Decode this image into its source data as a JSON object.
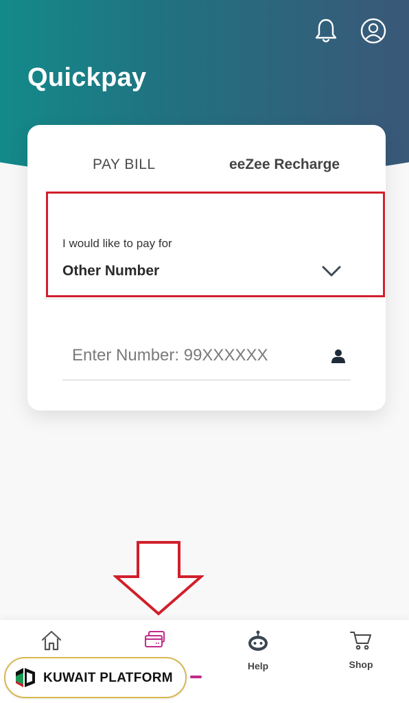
{
  "header": {
    "title": "Quickpay",
    "icons": [
      "bell-icon",
      "profile-icon"
    ]
  },
  "card": {
    "tabs": [
      {
        "label": "PAY BILL",
        "active": false
      },
      {
        "label": "eeZee Recharge",
        "active": true
      }
    ],
    "pay_for": {
      "label": "I would like to pay for",
      "value": "Other Number"
    },
    "number_field": {
      "placeholder": "Enter Number: 99XXXXXX",
      "value": ""
    }
  },
  "bottom_nav": {
    "items": [
      {
        "icon": "home-icon",
        "label": ""
      },
      {
        "icon": "card-icon",
        "label": ""
      },
      {
        "icon": "robot-icon",
        "label": "Help"
      },
      {
        "icon": "cart-icon",
        "label": "Shop"
      }
    ],
    "active_accent": "#c2298a"
  },
  "watermark": {
    "text": "KUWAIT PLATFORM"
  },
  "colors": {
    "header_gradient_start": "#138a8a",
    "header_gradient_end": "#3a5878",
    "annotation_red": "#d11f2a"
  }
}
